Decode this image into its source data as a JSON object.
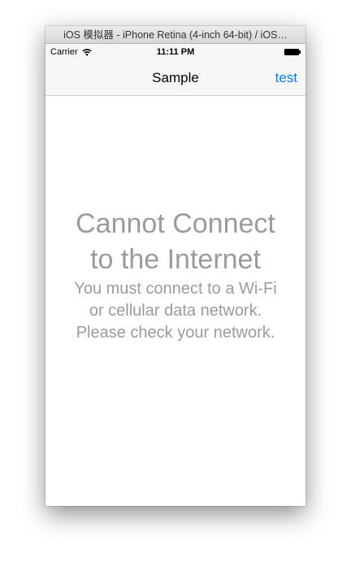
{
  "window": {
    "title": "iOS 模拟器 - iPhone Retina (4-inch 64-bit) / iOS…"
  },
  "status_bar": {
    "carrier": "Carrier",
    "wifi_icon": "wifi-icon",
    "time": "11:11 PM",
    "battery_icon": "battery-icon"
  },
  "nav_bar": {
    "title": "Sample",
    "right_button": "test"
  },
  "error": {
    "title_lines": [
      "Cannot Connect",
      "to the Internet"
    ],
    "message_lines": [
      "You must connect to a Wi-Fi",
      "or cellular data network.",
      "Please check your network."
    ]
  },
  "colors": {
    "accent": "#0a7aff",
    "error_text": "#9b9b9b"
  }
}
